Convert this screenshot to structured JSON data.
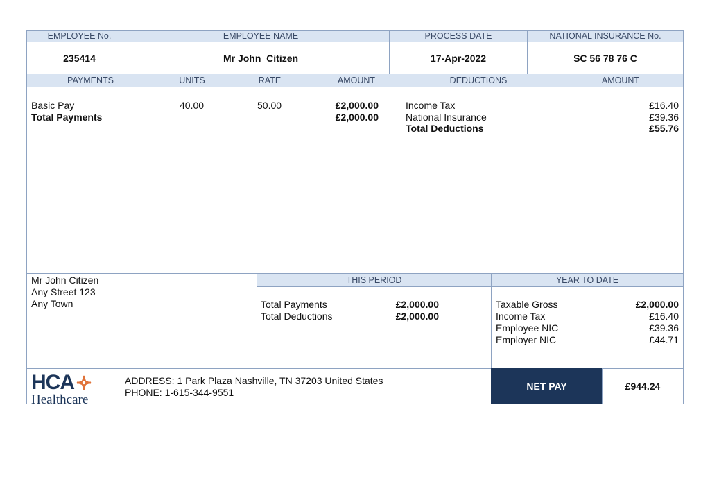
{
  "header": {
    "employee_no_label": "EMPLOYEE No.",
    "employee_name_label": "EMPLOYEE NAME",
    "process_date_label": "PROCESS DATE",
    "ni_no_label": "NATIONAL INSURANCE No.",
    "employee_no": "235414",
    "employee_name": "Mr John  Citizen",
    "process_date": "17-Apr-2022",
    "ni_no": "SC 56 78 76 C"
  },
  "payments": {
    "col_payments": "PAYMENTS",
    "col_units": "UNITS",
    "col_rate": "RATE",
    "col_amount": "AMOUNT",
    "rows": [
      {
        "label": "Basic Pay",
        "units": "40.00",
        "rate": "50.00",
        "amount": "£2,000.00"
      }
    ],
    "total_label": "Total Payments",
    "total_amount": "£2,000.00"
  },
  "deductions": {
    "col_deductions": "DEDUCTIONS",
    "col_amount": "AMOUNT",
    "rows": [
      {
        "label": "Income Tax",
        "amount": "£16.40"
      },
      {
        "label": "National Insurance",
        "amount": "£39.36"
      }
    ],
    "total_label": "Total Deductions",
    "total_amount": "£55.76"
  },
  "address": {
    "line1": "Mr John Citizen",
    "line2": "Any Street 123",
    "line3": "Any Town"
  },
  "this_period": {
    "label": "THIS PERIOD",
    "rows": [
      {
        "label": "Total Payments",
        "amount": "£2,000.00"
      },
      {
        "label": "Total Deductions",
        "amount": "£2,000.00"
      }
    ]
  },
  "year_to_date": {
    "label": "YEAR TO DATE",
    "rows": [
      {
        "label": "Taxable Gross",
        "amount": "£2,000.00",
        "bold": true
      },
      {
        "label": "Income Tax",
        "amount": "£16.40"
      },
      {
        "label": "Employee NIC",
        "amount": "£39.36"
      },
      {
        "label": "Employer NIC",
        "amount": "£44.71"
      }
    ]
  },
  "footer": {
    "logo_top": "HCA",
    "logo_bottom": "Healthcare",
    "address": "ADDRESS: 1 Park Plaza Nashville, TN 37203 United States",
    "phone": "PHONE: 1-615-344-9551",
    "net_pay_label": "NET PAY",
    "net_pay_value": "£944.24"
  },
  "colors": {
    "header_bg": "#d9e4f2",
    "border": "#8ea3c2",
    "navy": "#1c3559",
    "logo_orange": "#e0733a"
  }
}
